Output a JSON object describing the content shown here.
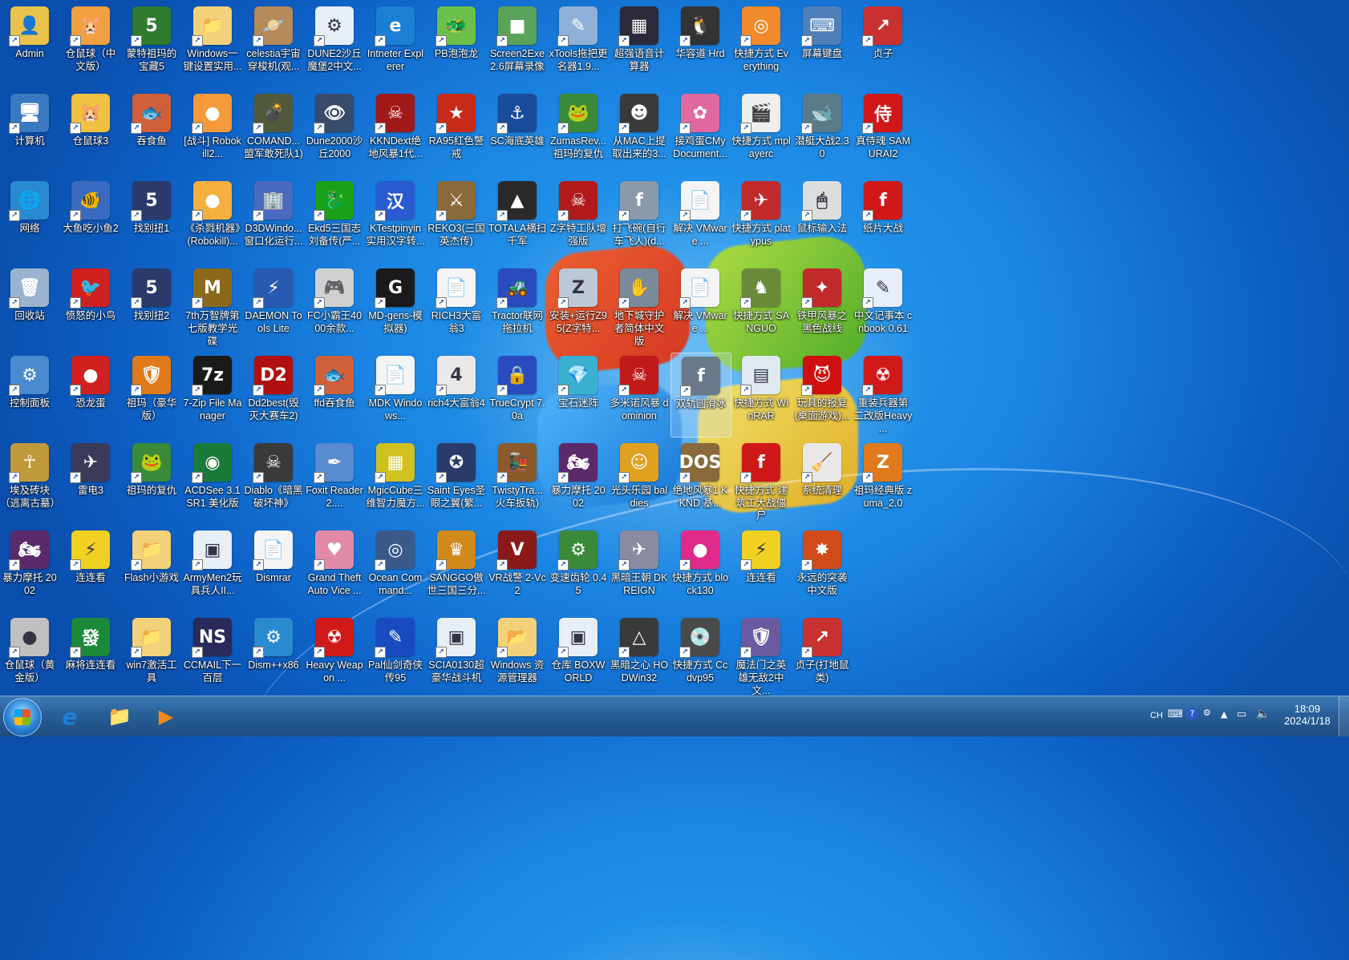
{
  "desktop": {
    "icons": [
      {
        "label": "Admin",
        "icon": "user-folder-icon",
        "color": "#e8c24a",
        "glyph": "👤"
      },
      {
        "label": "仓鼠球（中文版）",
        "icon": "hamster-icon",
        "color": "#f0a040",
        "glyph": "🐹"
      },
      {
        "label": "蒙特祖玛的宝藏5",
        "icon": "game-icon",
        "color": "#2f7a2f",
        "glyph": "5"
      },
      {
        "label": "Windows一键设置实用...",
        "icon": "folder-icon",
        "color": "#f3d17a",
        "glyph": "📁"
      },
      {
        "label": "celestia宇宙穿梭机(观...",
        "icon": "planet-icon",
        "color": "#b48a5a",
        "glyph": "🪐"
      },
      {
        "label": "DUNE2沙丘魔堡2中文...",
        "icon": "settings-app-icon",
        "color": "#e8eef5",
        "glyph": "⚙"
      },
      {
        "label": "Intneter Explerer",
        "icon": "ie-icon",
        "color": "#1b7fd6",
        "glyph": "e"
      },
      {
        "label": "PB泡泡龙",
        "icon": "bubble-dragon-icon",
        "color": "#6cc04a",
        "glyph": "🐲"
      },
      {
        "label": "Screen2Exe 2.6屏幕录像",
        "icon": "screen-recorder-icon",
        "color": "#5aa35a",
        "glyph": "■"
      },
      {
        "label": "xTools拖把更名器1.9...",
        "icon": "tools-icon",
        "color": "#8fb0d8",
        "glyph": "✎"
      },
      {
        "label": "超强语音计算器",
        "icon": "calculator-icon",
        "color": "#2a2a3a",
        "glyph": "▦"
      },
      {
        "label": "华容道 Hrd",
        "icon": "penguin-icon",
        "color": "#333333",
        "glyph": "🐧"
      },
      {
        "label": "快捷方式 Everything",
        "icon": "everything-search-icon",
        "color": "#f08a2a",
        "glyph": "◎"
      },
      {
        "label": "屏幕键盘",
        "icon": "keyboard-icon",
        "color": "#4f7fb8",
        "glyph": "⌨"
      },
      {
        "label": "贞子",
        "icon": "shortcut-red-icon",
        "color": "#c93030",
        "glyph": "↗"
      },
      {
        "label": "计算机",
        "icon": "computer-icon",
        "color": "#3a78c0",
        "glyph": "🖥"
      },
      {
        "label": "仓鼠球3",
        "icon": "hamster-icon",
        "color": "#f0c040",
        "glyph": "🐹"
      },
      {
        "label": "吞食鱼",
        "icon": "fish-icon",
        "color": "#d0603a",
        "glyph": "🐟"
      },
      {
        "label": "[战斗] Robokill2...",
        "icon": "robokill-icon",
        "color": "#f59a3a",
        "glyph": "●"
      },
      {
        "label": "COMAND...盟军敢死队1)",
        "icon": "grenade-icon",
        "color": "#505a3a",
        "glyph": "💣"
      },
      {
        "label": "Dune2000沙丘2000",
        "icon": "eye-icon",
        "color": "#3a4a6a",
        "glyph": "👁"
      },
      {
        "label": "KKNDext绝地风暴1代...",
        "icon": "kknd-icon",
        "color": "#a01818",
        "glyph": "☠"
      },
      {
        "label": "RA95红色警戒",
        "icon": "red-alert-icon",
        "color": "#c82a1a",
        "glyph": "★"
      },
      {
        "label": "SC海底英雄",
        "icon": "submarine-icon",
        "color": "#1a4a9a",
        "glyph": "⚓"
      },
      {
        "label": "ZumasRev...祖玛的复仇",
        "icon": "zuma-icon",
        "color": "#3a8a3a",
        "glyph": "🐸"
      },
      {
        "label": "从MAC上提取出来的3...",
        "icon": "game-icon",
        "color": "#3a3a3a",
        "glyph": "☻"
      },
      {
        "label": "接鸡蛋CMy Document...",
        "icon": "egg-icon",
        "color": "#e06aa0",
        "glyph": "✿"
      },
      {
        "label": "快捷方式 mplayerc",
        "icon": "clapper-icon",
        "color": "#eeeeee",
        "glyph": "🎬"
      },
      {
        "label": "潜艇大战2.30",
        "icon": "submarine-fish-icon",
        "color": "#5a7a8a",
        "glyph": "🐋"
      },
      {
        "label": "真侍魂 SAMURAI2",
        "icon": "samurai-icon",
        "color": "#d01818",
        "glyph": "侍"
      },
      {
        "label": "网络",
        "icon": "network-icon",
        "color": "#2a8ad0",
        "glyph": "🌐"
      },
      {
        "label": "大鱼吃小鱼2",
        "icon": "fish-icon",
        "color": "#3a6ac0",
        "glyph": "🐠"
      },
      {
        "label": "找别扭1",
        "icon": "number-five-icon",
        "color": "#2a3a6a",
        "glyph": "5"
      },
      {
        "label": "《杀戮机器》(Robokill)...",
        "icon": "robokill-icon",
        "color": "#f5b040",
        "glyph": "●"
      },
      {
        "label": "D3DWindo...窗口化运行...",
        "icon": "buildings-icon",
        "color": "#4a6ac0",
        "glyph": "🏢"
      },
      {
        "label": "Ekd5三国志刘备传(严...",
        "icon": "dragon-icon",
        "color": "#1aa01a",
        "glyph": "🐉"
      },
      {
        "label": "KTestpinyin实用汉字转...",
        "icon": "hanzi-icon",
        "color": "#2a5ad0",
        "glyph": "汉"
      },
      {
        "label": "REKO3(三国英杰传)",
        "icon": "warrior-icon",
        "color": "#8a6a3a",
        "glyph": "⚔"
      },
      {
        "label": "TOTALA横扫千军",
        "icon": "totala-icon",
        "color": "#2a2a2a",
        "glyph": "▲"
      },
      {
        "label": "Z字特工队增强版",
        "icon": "skull-icon",
        "color": "#b01a1a",
        "glyph": "☠"
      },
      {
        "label": "打飞碗(自行车飞人)(d...",
        "icon": "flash-icon",
        "color": "#8a9aaa",
        "glyph": "f"
      },
      {
        "label": "解决 VMware ...",
        "icon": "document-icon",
        "color": "#f4f4f4",
        "glyph": "📄"
      },
      {
        "label": "快捷方式 platypus",
        "icon": "plane-icon",
        "color": "#c02a2a",
        "glyph": "✈"
      },
      {
        "label": "鼠标输入法",
        "icon": "mouse-icon",
        "color": "#dddddd",
        "glyph": "🖱"
      },
      {
        "label": "纸片大战",
        "icon": "flash-icon",
        "color": "#d01818",
        "glyph": "f"
      },
      {
        "label": "回收站",
        "icon": "recycle-bin-icon",
        "color": "#9ab4d0",
        "glyph": "🗑"
      },
      {
        "label": "愤怒的小鸟",
        "icon": "angry-bird-icon",
        "color": "#d02020",
        "glyph": "🐦"
      },
      {
        "label": "找别扭2",
        "icon": "number-five-icon",
        "color": "#2a3a6a",
        "glyph": "5"
      },
      {
        "label": "7th万智牌第七版教学光碟",
        "icon": "magic-card-icon",
        "color": "#8a6a1a",
        "glyph": "M"
      },
      {
        "label": "DAEMON Tools Lite",
        "icon": "daemon-tools-icon",
        "color": "#2a5ab0",
        "glyph": "⚡"
      },
      {
        "label": "FC小霸王4000余款...",
        "icon": "fc-console-icon",
        "color": "#d0d0d0",
        "glyph": "🎮"
      },
      {
        "label": "MD-gens-模拟器)",
        "icon": "gens-icon",
        "color": "#1a1a1a",
        "glyph": "G"
      },
      {
        "label": "RICH3大富翁3",
        "icon": "document-icon",
        "color": "#f4f4f4",
        "glyph": "📄"
      },
      {
        "label": "Tractor联网拖拉机",
        "icon": "tractor-icon",
        "color": "#2a4ac0",
        "glyph": "🚜"
      },
      {
        "label": "安装+运行Z95(Z字特...",
        "icon": "installer-icon",
        "color": "#bcc8d8",
        "glyph": "Z"
      },
      {
        "label": "地下城守护者简体中文版",
        "icon": "dungeon-keeper-icon",
        "color": "#7a8a9a",
        "glyph": "✋"
      },
      {
        "label": "解决 VMware ...",
        "icon": "document-icon",
        "color": "#f4f4f4",
        "glyph": "📄"
      },
      {
        "label": "快捷方式 SANGUO",
        "icon": "soldier-icon",
        "color": "#6a8a3a",
        "glyph": "♞"
      },
      {
        "label": "铁甲风暴之黑色战线",
        "icon": "mech-icon",
        "color": "#c02a2a",
        "glyph": "✦"
      },
      {
        "label": "中文记事本 cnbook 0.61",
        "icon": "notepad-icon",
        "color": "#e8eef8",
        "glyph": "✎"
      },
      {
        "label": "控制面板",
        "icon": "control-panel-icon",
        "color": "#4a8ad0",
        "glyph": "⚙"
      },
      {
        "label": "恐龙蛋",
        "icon": "dino-egg-icon",
        "color": "#d02020",
        "glyph": "●"
      },
      {
        "label": "祖玛（豪华版）",
        "icon": "zuma-installer-icon",
        "color": "#e07a1a",
        "glyph": "🛡"
      },
      {
        "label": "7-Zip File Manager",
        "icon": "7zip-icon",
        "color": "#1a1a1a",
        "glyph": "7z"
      },
      {
        "label": "Dd2best(毁灭大赛车2)",
        "icon": "dd2-icon",
        "color": "#b01010",
        "glyph": "D2"
      },
      {
        "label": "ffd吞食鱼",
        "icon": "fish-icon",
        "color": "#d0603a",
        "glyph": "🐟"
      },
      {
        "label": "MDK Windows...",
        "icon": "document-icon",
        "color": "#f4f4f4",
        "glyph": "📄"
      },
      {
        "label": "rich4大富翁4",
        "icon": "dice-icon",
        "color": "#e8e8e8",
        "glyph": "4"
      },
      {
        "label": "TrueCrypt 7.0a",
        "icon": "truecrypt-icon",
        "color": "#2a4ac0",
        "glyph": "🔒"
      },
      {
        "label": "宝石迷阵",
        "icon": "gem-icon",
        "color": "#3ab0d0",
        "glyph": "💎"
      },
      {
        "label": "多米诺风暴 dominion",
        "icon": "dominion-icon",
        "color": "#c01a1a",
        "glyph": "☠"
      },
      {
        "label": "双轨圆滑冰",
        "icon": "flash-icon",
        "color": "#6a7a8a",
        "glyph": "f"
      },
      {
        "label": "快捷方式 WinRAR",
        "icon": "winrar-icon",
        "color": "#e0e8f0",
        "glyph": "▤"
      },
      {
        "label": "玩具的报复(桌面游戏)...",
        "icon": "devil-icon",
        "color": "#d01010",
        "glyph": "😈"
      },
      {
        "label": "重装兵器第二改版Heavy ...",
        "icon": "radiation-icon",
        "color": "#d01a1a",
        "glyph": "☢"
      },
      {
        "label": "埃及砖块（逃离古墓）",
        "icon": "ankh-icon",
        "color": "#c09a3a",
        "glyph": "☥"
      },
      {
        "label": "雷电3",
        "icon": "fighter-jet-icon",
        "color": "#3a3a5a",
        "glyph": "✈"
      },
      {
        "label": "祖玛的复仇",
        "icon": "zuma-icon",
        "color": "#3a8a3a",
        "glyph": "🐸"
      },
      {
        "label": "ACDSee 3.1 SR1 美化版",
        "icon": "acdsee-eye-icon",
        "color": "#1a7a3a",
        "glyph": "◉"
      },
      {
        "label": "Diablo《暗黑破坏神》",
        "icon": "diablo-skull-icon",
        "color": "#3a3a3a",
        "glyph": "☠"
      },
      {
        "label": "Foxit Reader 2....",
        "icon": "foxit-icon",
        "color": "#5a8ad0",
        "glyph": "✒"
      },
      {
        "label": "MgicCube三维智力魔方...",
        "icon": "rubik-cube-icon",
        "color": "#d0c020",
        "glyph": "▦"
      },
      {
        "label": "Saint Eyes圣眼之翼(繁...",
        "icon": "saint-eyes-icon",
        "color": "#2a3a6a",
        "glyph": "✪"
      },
      {
        "label": "TwistyTra...火车扳轨)",
        "icon": "train-icon",
        "color": "#8a5a2a",
        "glyph": "🚂"
      },
      {
        "label": "暴力摩托 2002",
        "icon": "motorbike-icon",
        "color": "#5a2a6a",
        "glyph": "🏍"
      },
      {
        "label": "光头乐园 baldies",
        "icon": "baldies-icon",
        "color": "#e0a020",
        "glyph": "☺"
      },
      {
        "label": "绝地风暴1 KKND 基...",
        "icon": "dosbox-icon",
        "color": "#8a6a3a",
        "glyph": "DOS"
      },
      {
        "label": "快捷方式 建筑工大战僵尸",
        "icon": "flash-icon",
        "color": "#d01818",
        "glyph": "f"
      },
      {
        "label": "系统清理",
        "icon": "system-cleaner-icon",
        "color": "#e8e8e8",
        "glyph": "🧹"
      },
      {
        "label": "祖玛经典版 zuma_2.0",
        "icon": "zuma-installer-icon",
        "color": "#e07a1a",
        "glyph": "Z"
      },
      {
        "label": "暴力摩托 2002",
        "icon": "motorbike-icon",
        "color": "#5a2a6a",
        "glyph": "🏍"
      },
      {
        "label": "连连看",
        "icon": "pikachu-icon",
        "color": "#f0d020",
        "glyph": "⚡"
      },
      {
        "label": "Flash小游戏",
        "icon": "folder-icon",
        "color": "#f3d17a",
        "glyph": "📁"
      },
      {
        "label": "ArmyMen2玩具兵人II...",
        "icon": "app-window-icon",
        "color": "#e8eef5",
        "glyph": "▣"
      },
      {
        "label": "Dismrar",
        "icon": "document-icon",
        "color": "#f4f4f4",
        "glyph": "📄"
      },
      {
        "label": "Grand Theft Auto Vice ...",
        "icon": "gta-icon",
        "color": "#e08aa8",
        "glyph": "♥"
      },
      {
        "label": "Ocean Command...",
        "icon": "ocean-command-icon",
        "color": "#3a5a8a",
        "glyph": "◎"
      },
      {
        "label": "SANGGO傲世三国三分...",
        "icon": "sanguo-icon",
        "color": "#d08a1a",
        "glyph": "♛"
      },
      {
        "label": "VR战警 2-Vc2",
        "icon": "vr-cop-icon",
        "color": "#8a1a1a",
        "glyph": "V"
      },
      {
        "label": "变速齿轮 0.45",
        "icon": "gear-speed-icon",
        "color": "#3a8a3a",
        "glyph": "⚙"
      },
      {
        "label": "黑暗王朝 DKREIGN",
        "icon": "dkreign-icon",
        "color": "#8a8aa0",
        "glyph": "✈"
      },
      {
        "label": "快捷方式 block130",
        "icon": "ball-icon",
        "color": "#e02a8a",
        "glyph": "●"
      },
      {
        "label": "连连看",
        "icon": "pikachu-icon",
        "color": "#f0d020",
        "glyph": "⚡"
      },
      {
        "label": "永远的突袭中文版",
        "icon": "explosion-icon",
        "color": "#d04a1a",
        "glyph": "✸"
      },
      {
        "label": "",
        "icon": "",
        "color": "",
        "glyph": ""
      },
      {
        "label": "仓鼠球（黄金版）",
        "icon": "hamster-ball-icon",
        "color": "#c0c0c0",
        "glyph": "●"
      },
      {
        "label": "麻将连连看",
        "icon": "mahjong-icon",
        "color": "#1a8a3a",
        "glyph": "發"
      },
      {
        "label": "win7激活工具",
        "icon": "folder-icon",
        "color": "#f3d17a",
        "glyph": "📁"
      },
      {
        "label": "CCMAIL下一百层",
        "icon": "ns-icon",
        "color": "#2a2a5a",
        "glyph": "NS"
      },
      {
        "label": "Dism++x86",
        "icon": "dism-gears-icon",
        "color": "#2a8ad0",
        "glyph": "⚙"
      },
      {
        "label": "Heavy Weapon ...",
        "icon": "radiation-icon",
        "color": "#d01a1a",
        "glyph": "☢"
      },
      {
        "label": "Pal仙剑奇侠传95",
        "icon": "pal-icon",
        "color": "#1a4ac0",
        "glyph": "✎"
      },
      {
        "label": "SCIA0130超豪华战斗机",
        "icon": "app-window-icon",
        "color": "#e8eef5",
        "glyph": "▣"
      },
      {
        "label": "Windows 资源管理器",
        "icon": "explorer-icon",
        "color": "#f3d17a",
        "glyph": "📂"
      },
      {
        "label": "仓库 BOXWORLD",
        "icon": "app-window-icon",
        "color": "#e8eef5",
        "glyph": "▣"
      },
      {
        "label": "黑暗之心 HODWin32",
        "icon": "dark-heart-icon",
        "color": "#3a3a3a",
        "glyph": "△"
      },
      {
        "label": "快捷方式 Ccdvp95",
        "icon": "calculator-disc-icon",
        "color": "#4a4a4a",
        "glyph": "💿"
      },
      {
        "label": "魔法门之英雄无敌2中文...",
        "icon": "shield-icon",
        "color": "#6a5aa0",
        "glyph": "🛡"
      },
      {
        "label": "贞子(打地鼠类)",
        "icon": "shortcut-red-icon",
        "color": "#c93030",
        "glyph": "↗"
      }
    ]
  },
  "taskbar": {
    "start_label": "Start",
    "pinned": [
      {
        "name": "internet-explorer",
        "glyph": "e",
        "color": "#1b7fd6"
      },
      {
        "name": "file-explorer",
        "glyph": "📁",
        "color": "#f3d17a"
      },
      {
        "name": "media-player",
        "glyph": "▶",
        "color": "#f08a1a"
      }
    ],
    "tray": {
      "ime": "CH",
      "time": "18:09",
      "date": "2024/1/18"
    }
  }
}
